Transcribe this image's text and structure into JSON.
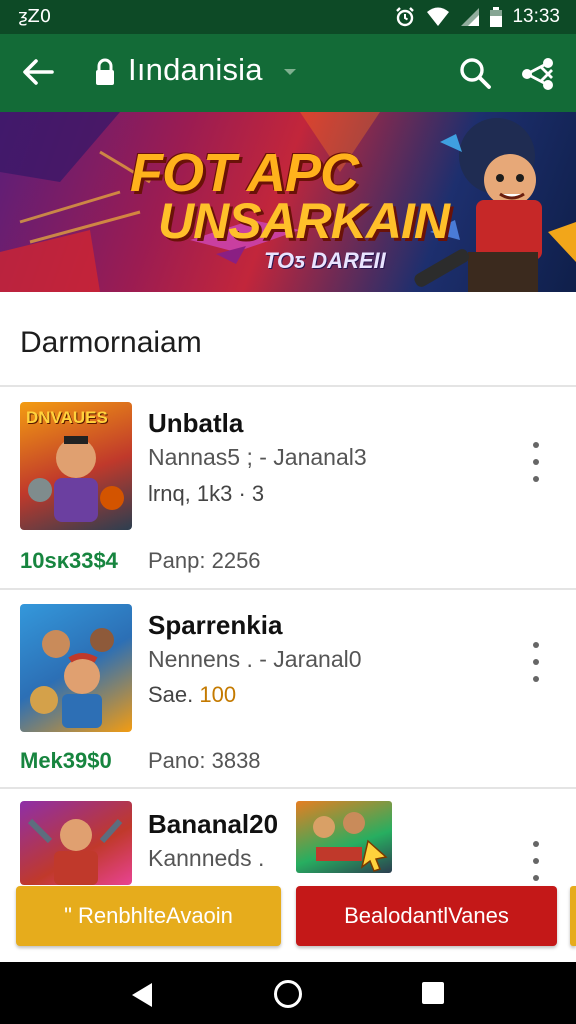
{
  "status_bar": {
    "left_text": "ƺZ0",
    "time": "13:33"
  },
  "app_bar": {
    "title": "Iındanisia"
  },
  "banner": {
    "line1": "FOT APC",
    "line2": "UNSARKAIN",
    "line3": "TOƽ DAREII"
  },
  "section": {
    "title": "Darmornaiam"
  },
  "apps": [
    {
      "name": "Unbatla",
      "subtitle": "Nannas5 ; - Jananal3",
      "meta": "lrnq, 1k3 · 3",
      "price": "10sκ33$4",
      "pano": "Panp: 2256",
      "thumb_title": "DNVAUES"
    },
    {
      "name": "Sparrenkia",
      "subtitle": "Nennens . - Jaranal0",
      "meta_label": "Sae.",
      "meta_value": "100",
      "price": "Mek39$0",
      "pano": "Pano: 3838"
    },
    {
      "name": "Bananal20",
      "subtitle": "Kannneds ."
    }
  ],
  "buttons": {
    "primary": "\" RenbhlteAvaoin",
    "secondary": "BealodantlVanes"
  },
  "colors": {
    "status_bar": "#0d4a26",
    "app_bar": "#136b37",
    "price_green": "#17853f",
    "btn_yellow": "#e6ac1c",
    "btn_red": "#c41818"
  }
}
